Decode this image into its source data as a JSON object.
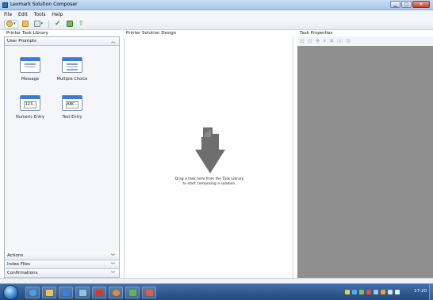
{
  "window": {
    "title": "Lexmark Solution Composer"
  },
  "menu": {
    "file": "File",
    "edit": "Edit",
    "tools": "Tools",
    "help": "Help"
  },
  "panes": {
    "library_title": "Printer Task Library",
    "design_title": "Printer Solution Design",
    "properties_title": "Task Properties"
  },
  "library": {
    "user_prompts": "User Prompts",
    "tiles": {
      "message": "Message",
      "multiple_choice": "Multiple Choice",
      "numeric_entry": "Numeric Entry",
      "text_entry": "Text Entry"
    },
    "numeric_icon_text": "123..",
    "text_icon_text": "ABC..",
    "sections": {
      "actions": "Actions",
      "index_files": "Index Files",
      "confirmations": "Confirmations"
    }
  },
  "design": {
    "drop_hint_line1": "Drag a task here from the Task Library",
    "drop_hint_line2": "to start composing a solution."
  },
  "taskbar": {
    "clock": "17:20"
  },
  "colors": {
    "accent": "#3b7bd4",
    "properties_bg": "#8f8f8f",
    "arrow": "#6e6e6e"
  }
}
